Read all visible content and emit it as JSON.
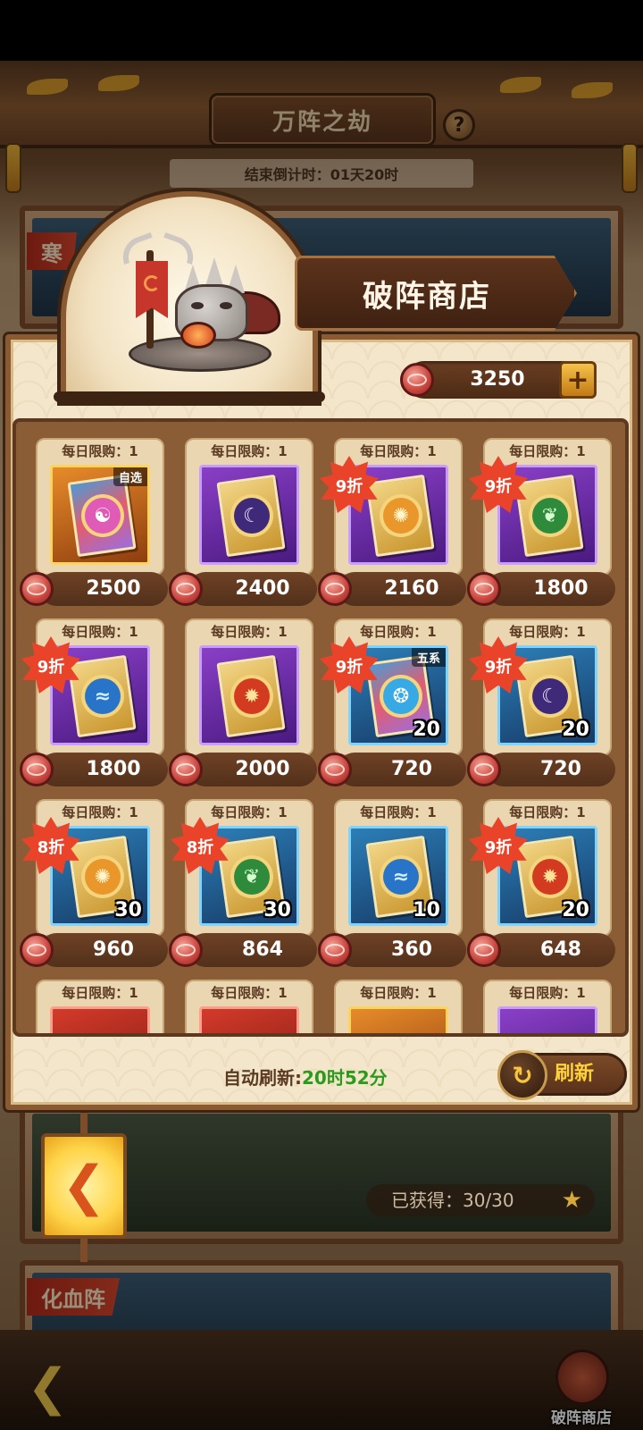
{
  "event": {
    "title": "万阵之劫",
    "help_symbol": "?",
    "countdown": "结束倒计时：01天20时",
    "bg_label_top": "寒",
    "bg_label_bottom": "化血阵"
  },
  "shop": {
    "title": "破阵商店",
    "currency_amount": "3250",
    "plus_symbol": "+",
    "items": [
      {
        "limit": "每日限购：1",
        "price": "2500",
        "discount": "",
        "qty": "",
        "tag": "自选",
        "rarity": "orange",
        "element": "yin"
      },
      {
        "limit": "每日限购：1",
        "price": "2400",
        "discount": "",
        "qty": "",
        "tag": "",
        "rarity": "purple",
        "element": "moon"
      },
      {
        "limit": "每日限购：1",
        "price": "2160",
        "discount": "9折",
        "qty": "",
        "tag": "",
        "rarity": "purple",
        "element": "sun"
      },
      {
        "limit": "每日限购：1",
        "price": "1800",
        "discount": "9折",
        "qty": "",
        "tag": "",
        "rarity": "purple",
        "element": "wood"
      },
      {
        "limit": "每日限购：1",
        "price": "1800",
        "discount": "9折",
        "qty": "",
        "tag": "",
        "rarity": "purple",
        "element": "water"
      },
      {
        "limit": "每日限购：1",
        "price": "2000",
        "discount": "",
        "qty": "",
        "tag": "",
        "rarity": "purple",
        "element": "fire"
      },
      {
        "limit": "每日限购：1",
        "price": "720",
        "discount": "9折",
        "qty": "20",
        "tag": "五系",
        "rarity": "blue",
        "element": "spirit"
      },
      {
        "limit": "每日限购：1",
        "price": "720",
        "discount": "9折",
        "qty": "20",
        "tag": "",
        "rarity": "blue",
        "element": "moon"
      },
      {
        "limit": "每日限购：1",
        "price": "960",
        "discount": "8折",
        "qty": "30",
        "tag": "",
        "rarity": "blue",
        "element": "sun"
      },
      {
        "limit": "每日限购：1",
        "price": "864",
        "discount": "8折",
        "qty": "30",
        "tag": "",
        "rarity": "blue",
        "element": "wood"
      },
      {
        "limit": "每日限购：1",
        "price": "360",
        "discount": "",
        "qty": "10",
        "tag": "",
        "rarity": "blue",
        "element": "water"
      },
      {
        "limit": "每日限购：1",
        "price": "648",
        "discount": "9折",
        "qty": "20",
        "tag": "",
        "rarity": "blue",
        "element": "fire"
      },
      {
        "limit": "每日限购：1",
        "price": "",
        "discount": "",
        "qty": "",
        "tag": "",
        "rarity": "red",
        "element": ""
      },
      {
        "limit": "每日限购：1",
        "price": "",
        "discount": "",
        "qty": "",
        "tag": "",
        "rarity": "red",
        "element": ""
      },
      {
        "limit": "每日限购：1",
        "price": "",
        "discount": "",
        "qty": "",
        "tag": "",
        "rarity": "orange",
        "element": ""
      },
      {
        "limit": "每日限购：1",
        "price": "",
        "discount": "",
        "qty": "",
        "tag": "",
        "rarity": "purple",
        "element": ""
      }
    ],
    "auto_refresh_label": "自动刷新:",
    "auto_refresh_time": "20时52分",
    "refresh_label": "刷新"
  },
  "progress": {
    "obtained": "已获得：30/30"
  },
  "bottom": {
    "shop_label": "破阵商店"
  },
  "element_glyphs": {
    "moon": "☾",
    "sun": "✺",
    "wood": "❦",
    "water": "≈",
    "fire": "✹",
    "yin": "☯",
    "spirit": "❂"
  }
}
